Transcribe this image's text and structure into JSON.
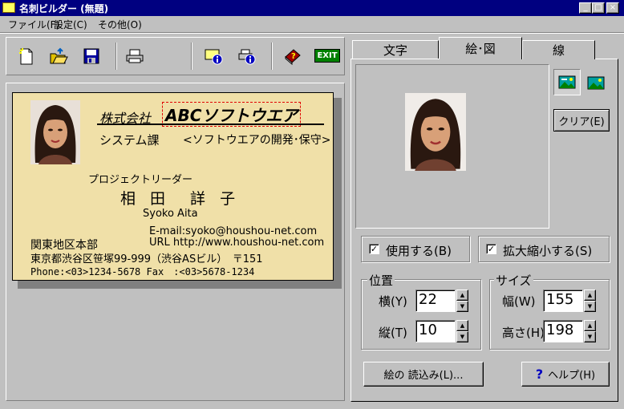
{
  "window": {
    "title": "名刺ビルダー (無題)",
    "minimize": "_",
    "maximize": "□",
    "close": "×"
  },
  "menu": [
    {
      "label": "ファイル(F)"
    },
    {
      "label": "設定(C)"
    },
    {
      "label": "その他(O)"
    }
  ],
  "toolbar": {
    "exit_label": "EXIT",
    "icons": [
      "new-document-icon",
      "open-folder-icon",
      "save-disk-icon",
      "print-icon",
      "card-info-icon",
      "printer-info-icon",
      "help-book-icon",
      "exit-icon"
    ]
  },
  "card": {
    "company_prefix": "株式会社",
    "company_name": "ABCソフトウエア",
    "department": "システム課",
    "tagline": "<ソフトウエアの開発･保守>",
    "position": "プロジェクトリーダー",
    "name": "相 田　詳 子",
    "name_roman": "Syoko Aita",
    "email": "E-mail:syoko@houshou-net.com",
    "url": "URL http://www.houshou-net.com",
    "office": "関東地区本部",
    "address": "東京都渋谷区笹塚99-999（渋谷ASビル）　〒151",
    "phone": "Phone:<03>1234-5678 Fax　:<03>5678-1234"
  },
  "tabs": [
    {
      "label": "文字",
      "active": false
    },
    {
      "label": "絵･図",
      "active": true
    },
    {
      "label": "線",
      "active": false
    }
  ],
  "picture_panel": {
    "clear_button": "クリア(E)",
    "use_checkbox": {
      "label": "使用する(B)",
      "checked": true
    },
    "scale_checkbox": {
      "label": "拡大縮小する(S)",
      "checked": true
    },
    "position_group": "位置",
    "x_label": "横(Y)",
    "x_value": "22",
    "y_label": "縦(T)",
    "y_value": "10",
    "size_group": "サイズ",
    "width_label": "幅(W)",
    "width_value": "155",
    "height_label": "高さ(H)",
    "height_value": "198",
    "load_button": "絵の 読込み(L)...",
    "help_button": "ヘルプ(H)",
    "help_icon": "?"
  },
  "colors": {
    "titlebar": "#000080",
    "card_background": "#f0e0a8",
    "face": "#c0c0c0"
  }
}
